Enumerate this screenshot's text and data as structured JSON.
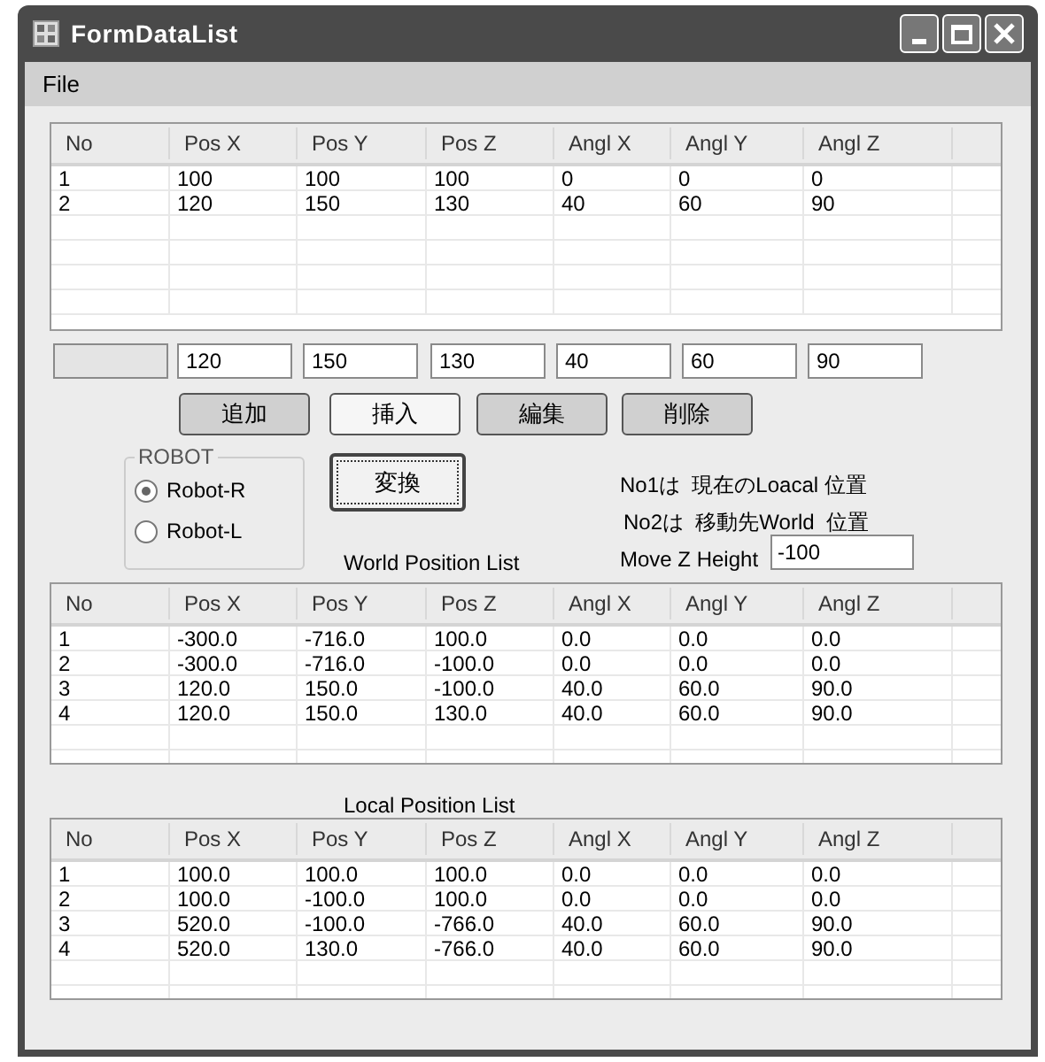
{
  "window": {
    "title": "FormDataList"
  },
  "menu": [
    "File"
  ],
  "input_list": {
    "columns": [
      "No",
      "Pos X",
      "Pos Y",
      "Pos Z",
      "Angl X",
      "Angl Y",
      "Angl Z"
    ],
    "rows": [
      [
        "1",
        "100",
        "100",
        "100",
        "0",
        "0",
        "0"
      ],
      [
        "2",
        "120",
        "150",
        "130",
        "40",
        "60",
        "90"
      ]
    ]
  },
  "edit_fields": [
    {
      "disabled": true
    },
    {
      "value": "120",
      "disabled": false
    },
    {
      "value": "150",
      "disabled": false
    },
    {
      "value": "130",
      "disabled": false
    },
    {
      "value": "40",
      "disabled": false
    },
    {
      "value": "60",
      "disabled": false
    },
    {
      "value": "90",
      "disabled": false
    }
  ],
  "buttons": [
    {
      "label": "追加",
      "pressed": true
    },
    {
      "label": "挿入",
      "pressed": false
    },
    {
      "label": "編集",
      "pressed": true
    },
    {
      "label": "削除",
      "pressed": true
    }
  ],
  "robot_group": {
    "title": "ROBOT",
    "options": [
      {
        "label": "Robot-R",
        "selected": true
      },
      {
        "label": "Robot-L",
        "selected": false
      }
    ]
  },
  "convert_button": {
    "label": "変換"
  },
  "notes": [
    "No1は  現在のLoacal 位置",
    "No2は  移動先World  位置"
  ],
  "world_list_label": "World Position List",
  "move_z": {
    "label": "Move Z Height",
    "value": "-100"
  },
  "world_list": {
    "columns": [
      "No",
      "Pos X",
      "Pos Y",
      "Pos Z",
      "Angl X",
      "Angl Y",
      "Angl Z"
    ],
    "rows": [
      [
        "1",
        "-300.0",
        "-716.0",
        "100.0",
        "0.0",
        "0.0",
        "0.0"
      ],
      [
        "2",
        "-300.0",
        "-716.0",
        "-100.0",
        "0.0",
        "0.0",
        "0.0"
      ],
      [
        "3",
        "120.0",
        "150.0",
        "-100.0",
        "40.0",
        "60.0",
        "90.0"
      ],
      [
        "4",
        "120.0",
        "150.0",
        "130.0",
        "40.0",
        "60.0",
        "90.0"
      ]
    ]
  },
  "local_list_label": "Local Position List",
  "local_list": {
    "columns": [
      "No",
      "Pos X",
      "Pos Y",
      "Pos Z",
      "Angl X",
      "Angl Y",
      "Angl Z"
    ],
    "rows": [
      [
        "1",
        "100.0",
        "100.0",
        "100.0",
        "0.0",
        "0.0",
        "0.0"
      ],
      [
        "2",
        "100.0",
        "-100.0",
        "100.0",
        "0.0",
        "0.0",
        "0.0"
      ],
      [
        "3",
        "520.0",
        "-100.0",
        "-766.0",
        "40.0",
        "60.0",
        "90.0"
      ],
      [
        "4",
        "520.0",
        "130.0",
        "-766.0",
        "40.0",
        "60.0",
        "90.0"
      ]
    ]
  }
}
